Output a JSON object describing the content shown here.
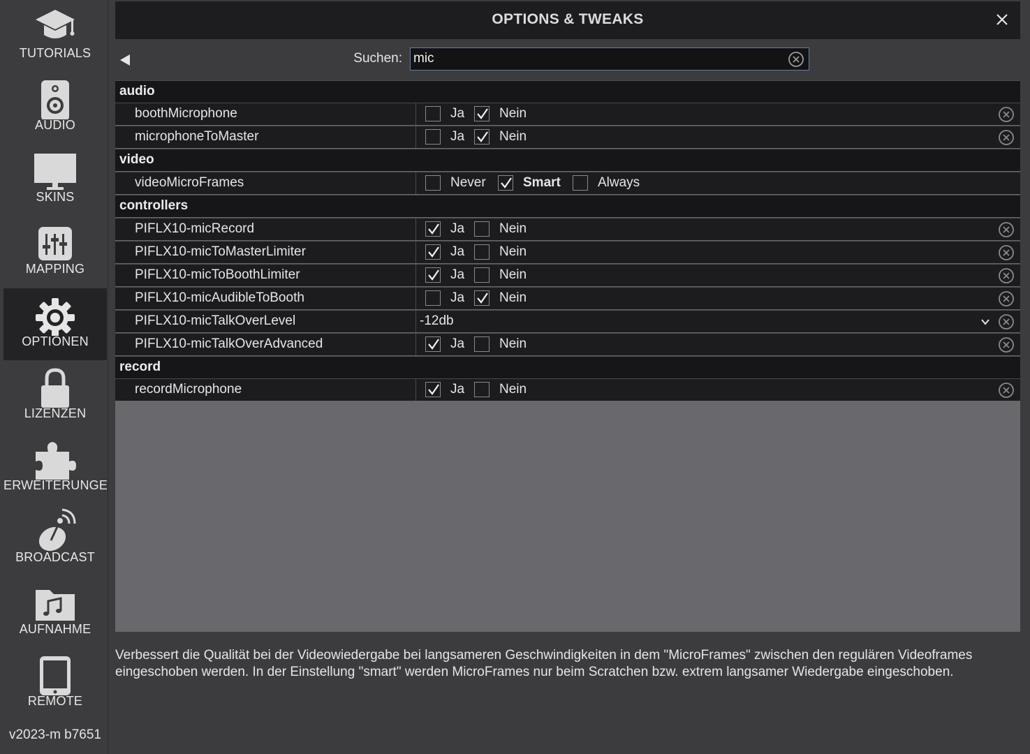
{
  "sidebar": {
    "items": [
      {
        "label": "TUTORIALS",
        "icon": "graduation-cap-icon"
      },
      {
        "label": "AUDIO",
        "icon": "speaker-icon"
      },
      {
        "label": "SKINS",
        "icon": "monitor-icon"
      },
      {
        "label": "MAPPING",
        "icon": "sliders-icon"
      },
      {
        "label": "OPTIONEN",
        "icon": "gear-icon",
        "active": true
      },
      {
        "label": "LIZENZEN",
        "icon": "lock-icon"
      },
      {
        "label": "ERWEITERUNGEI",
        "icon": "puzzle-icon"
      },
      {
        "label": "BROADCAST",
        "icon": "satellite-dish-icon"
      },
      {
        "label": "AUFNAHME",
        "icon": "music-folder-icon"
      },
      {
        "label": "REMOTE",
        "icon": "tablet-icon"
      }
    ],
    "version": "v2023-m b7651"
  },
  "header": {
    "title": "OPTIONS & TWEAKS"
  },
  "search": {
    "label": "Suchen:",
    "value": "mic"
  },
  "groups": {
    "audio": "audio",
    "video": "video",
    "controllers": "controllers",
    "record": "record"
  },
  "options": {
    "boothMicrophone": {
      "name": "boothMicrophone",
      "yes": "Ja",
      "no": "Nein",
      "value": "Nein"
    },
    "microphoneToMaster": {
      "name": "microphoneToMaster",
      "yes": "Ja",
      "no": "Nein",
      "value": "Nein"
    },
    "videoMicroFrames": {
      "name": "videoMicroFrames",
      "never": "Never",
      "smart": "Smart",
      "always": "Always",
      "value": "Smart"
    },
    "micRecord": {
      "name": "PIFLX10-micRecord",
      "yes": "Ja",
      "no": "Nein",
      "value": "Ja"
    },
    "micToMasterLimiter": {
      "name": "PIFLX10-micToMasterLimiter",
      "yes": "Ja",
      "no": "Nein",
      "value": "Ja"
    },
    "micToBoothLimiter": {
      "name": "PIFLX10-micToBoothLimiter",
      "yes": "Ja",
      "no": "Nein",
      "value": "Ja"
    },
    "micAudibleToBooth": {
      "name": "PIFLX10-micAudibleToBooth",
      "yes": "Ja",
      "no": "Nein",
      "value": "Nein"
    },
    "micTalkOverLevel": {
      "name": "PIFLX10-micTalkOverLevel",
      "value": "-12db"
    },
    "micTalkOverAdvanced": {
      "name": "PIFLX10-micTalkOverAdvanced",
      "yes": "Ja",
      "no": "Nein",
      "value": "Ja"
    },
    "recordMicrophone": {
      "name": "recordMicrophone",
      "yes": "Ja",
      "no": "Nein",
      "value": "Ja"
    }
  },
  "description": "Verbessert die Qualität bei der Videowiedergabe bei langsameren Geschwindigkeiten in dem \"MicroFrames\" zwischen den regulären Videoframes eingeschoben werden. In der Einstellung \"smart\" werden MicroFrames nur beim Scratchen bzw. extrem langsamer Wiedergabe eingeschoben.",
  "colors": {
    "background": "#3c3c3f",
    "row": "#1c1c1e",
    "empty": "#68686d",
    "search_border": "#6a7b9b"
  }
}
